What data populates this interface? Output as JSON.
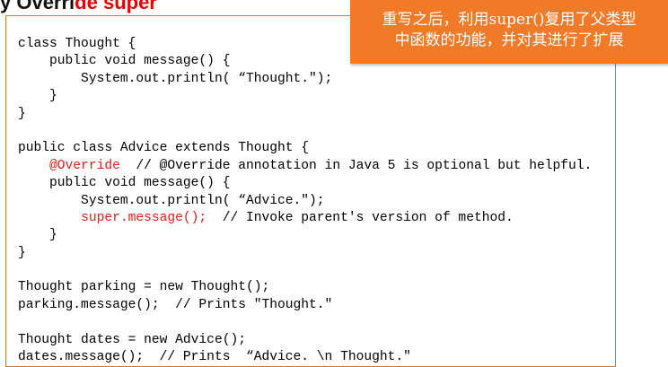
{
  "slide_title_fragment": {
    "black": "y Overri",
    "red": "de super"
  },
  "callout": {
    "line1": "重写之后，利用super()复用了父类型",
    "line2": "中函数的功能，并对其进行了扩展"
  },
  "code_lines": [
    {
      "segments": [
        {
          "text": "class Thought {",
          "red": false
        }
      ]
    },
    {
      "segments": [
        {
          "text": "    public void message() {",
          "red": false
        }
      ]
    },
    {
      "segments": [
        {
          "text": "        System.out.println( “Thought.\");",
          "red": false
        }
      ]
    },
    {
      "segments": [
        {
          "text": "    }",
          "red": false
        }
      ]
    },
    {
      "segments": [
        {
          "text": "}",
          "red": false
        }
      ]
    },
    {
      "segments": [
        {
          "text": "",
          "red": false
        }
      ]
    },
    {
      "segments": [
        {
          "text": "public class Advice extends Thought {",
          "red": false
        }
      ]
    },
    {
      "segments": [
        {
          "text": "    ",
          "red": false
        },
        {
          "text": "@Override",
          "red": true
        },
        {
          "text": "  // @Override annotation in Java 5 is optional but helpful.",
          "red": false
        }
      ]
    },
    {
      "segments": [
        {
          "text": "    public void message() {",
          "red": false
        }
      ]
    },
    {
      "segments": [
        {
          "text": "        System.out.println( “Advice.\");",
          "red": false
        }
      ]
    },
    {
      "segments": [
        {
          "text": "        ",
          "red": false
        },
        {
          "text": "super.message();",
          "red": true
        },
        {
          "text": "  // Invoke parent's version of method.",
          "red": false
        }
      ]
    },
    {
      "segments": [
        {
          "text": "    }",
          "red": false
        }
      ]
    },
    {
      "segments": [
        {
          "text": "}",
          "red": false
        }
      ]
    },
    {
      "segments": [
        {
          "text": "",
          "red": false
        }
      ]
    },
    {
      "segments": [
        {
          "text": "Thought parking = new Thought();",
          "red": false
        }
      ]
    },
    {
      "segments": [
        {
          "text": "parking.message();  // Prints \"Thought.\"",
          "red": false
        }
      ]
    },
    {
      "segments": [
        {
          "text": "",
          "red": false
        }
      ]
    },
    {
      "segments": [
        {
          "text": "Thought dates = new Advice();",
          "red": false
        }
      ]
    },
    {
      "segments": [
        {
          "text": "dates.message();  // Prints  “Advice. \\n Thought.\"",
          "red": false
        }
      ]
    }
  ],
  "colors": {
    "highlight_red": "#e0201b",
    "callout_bg": "#f07a28",
    "box_border": "#c87d3c"
  }
}
